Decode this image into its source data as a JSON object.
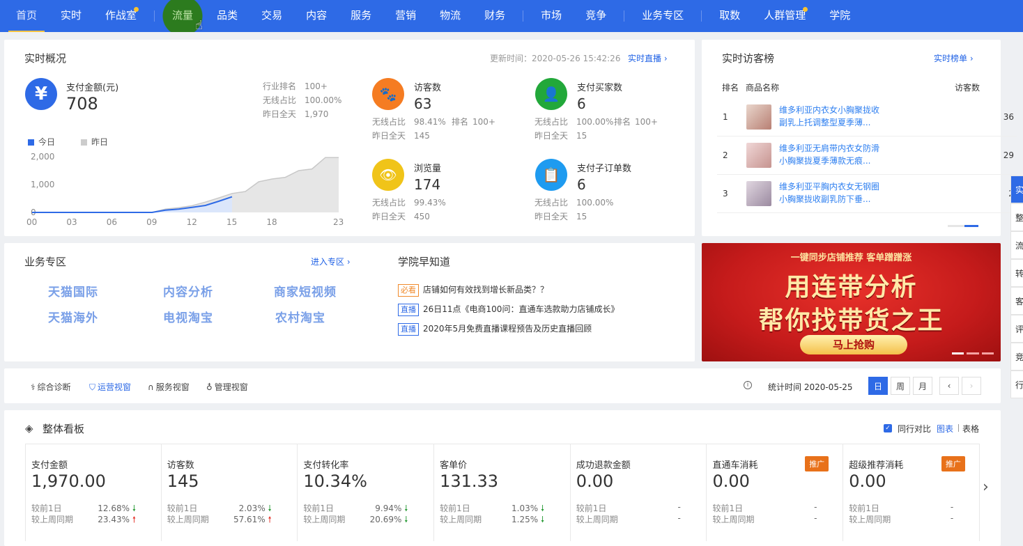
{
  "nav": {
    "items": [
      {
        "label": "首页",
        "active": true,
        "dot": false
      },
      {
        "label": "实时",
        "dot": false
      },
      {
        "label": "作战室",
        "dot": true
      },
      {
        "sep": true
      },
      {
        "label": "流量",
        "dot": false,
        "hover": true
      },
      {
        "label": "品类",
        "dot": false
      },
      {
        "label": "交易",
        "dot": false
      },
      {
        "label": "内容",
        "dot": false
      },
      {
        "label": "服务",
        "dot": false
      },
      {
        "label": "营销",
        "dot": false
      },
      {
        "label": "物流",
        "dot": false
      },
      {
        "label": "财务",
        "dot": false
      },
      {
        "sep": true
      },
      {
        "label": "市场",
        "dot": false
      },
      {
        "label": "竞争",
        "dot": false
      },
      {
        "sep": true
      },
      {
        "label": "业务专区",
        "dot": false
      },
      {
        "sep": true
      },
      {
        "label": "取数",
        "dot": false
      },
      {
        "label": "人群管理",
        "dot": true
      },
      {
        "label": "学院",
        "dot": false
      }
    ]
  },
  "realtime": {
    "title": "实时概况",
    "update_label": "更新时间：2020-05-26 15:42:26",
    "live_link": "实时直播",
    "pay": {
      "label": "支付金额(元)",
      "value": "708",
      "stats": [
        {
          "k": "行业排名",
          "v": "100+"
        },
        {
          "k": "无线占比",
          "v": "100.00%"
        },
        {
          "k": "昨日全天",
          "v": "1,970"
        }
      ]
    },
    "visitors": {
      "label": "访客数",
      "value": "63",
      "wireless_k": "无线占比",
      "wireless": "98.41%",
      "rank_k": "排名",
      "rank": "100+",
      "yday_k": "昨日全天",
      "yday": "145"
    },
    "buyers": {
      "label": "支付买家数",
      "value": "6",
      "wireless_k": "无线占比",
      "wireless": "100.00%",
      "rank_k": "排名",
      "rank": "100+",
      "yday_k": "昨日全天",
      "yday": "15"
    },
    "pv": {
      "label": "浏览量",
      "value": "174",
      "wireless_k": "无线占比",
      "wireless": "99.43%",
      "yday_k": "昨日全天",
      "yday": "450"
    },
    "suborders": {
      "label": "支付子订单数",
      "value": "6",
      "wireless_k": "无线占比",
      "wireless": "100.00%",
      "yday_k": "昨日全天",
      "yday": "15"
    },
    "legend_today": "今日",
    "legend_yesterday": "昨日"
  },
  "chart_data": {
    "type": "area",
    "x": [
      "00",
      "01",
      "02",
      "03",
      "04",
      "05",
      "06",
      "07",
      "08",
      "09",
      "10",
      "11",
      "12",
      "13",
      "14",
      "15",
      "16",
      "17",
      "18",
      "19",
      "20",
      "21",
      "22",
      "23"
    ],
    "xticks": [
      "00",
      "03",
      "06",
      "09",
      "12",
      "15",
      "18",
      "23"
    ],
    "yticks": [
      "2,000",
      "1,000",
      "0"
    ],
    "ylim": [
      0,
      2000
    ],
    "series": [
      {
        "name": "今日",
        "color": "#2e6ae6",
        "values": [
          0,
          0,
          0,
          0,
          0,
          0,
          0,
          0,
          0,
          0,
          80,
          120,
          180,
          250,
          400,
          560
        ]
      },
      {
        "name": "昨日",
        "color": "#c8c8c8",
        "values": [
          0,
          0,
          0,
          0,
          0,
          0,
          0,
          0,
          0,
          0,
          120,
          170,
          240,
          370,
          520,
          680,
          750,
          1100,
          1200,
          1260,
          1500,
          1560,
          1970,
          1970
        ]
      }
    ]
  },
  "visitor_rank": {
    "title": "实时访客榜",
    "link": "实时榜单",
    "col_rank": "排名",
    "col_name": "商品名称",
    "col_visitors": "访客数",
    "rows": [
      {
        "rank": "1",
        "name": "维多利亚内衣女小胸聚拢收副乳上托调整型夏季薄...",
        "visitors": "36"
      },
      {
        "rank": "2",
        "name": "维多利亚无肩带内衣女防滑小胸聚拢夏季薄款无痕...",
        "visitors": "29"
      },
      {
        "rank": "3",
        "name": "维多利亚平胸内衣女无钢圈小胸聚拢收副乳防下垂...",
        "visitors": "2"
      }
    ]
  },
  "biz_zone": {
    "title": "业务专区",
    "link": "进入专区",
    "items": [
      "天猫国际",
      "内容分析",
      "商家短视频",
      "天猫海外",
      "电视淘宝",
      "农村淘宝"
    ]
  },
  "academy": {
    "title": "学院早知道",
    "items": [
      {
        "tag": "必看",
        "must": true,
        "text": "店铺如何有效找到增长新品类？？"
      },
      {
        "tag": "直播",
        "must": false,
        "text": "26日11点《电商100问：直通车选款助力店铺成长》"
      },
      {
        "tag": "直播",
        "must": false,
        "text": "2020年5月免费直播课程预告及历史直播回顾"
      }
    ]
  },
  "banner": {
    "top": "一键同步店铺推荐 客单蹭蹭涨",
    "line1": "用连带分析",
    "line2": "帮你找带货之王",
    "cta": "马上抢购"
  },
  "view_tabs": {
    "items": [
      {
        "label": "综合诊断",
        "icon": "stethoscope-icon"
      },
      {
        "label": "运营视窗",
        "icon": "shield-icon",
        "active": true
      },
      {
        "label": "服务视窗",
        "icon": "headset-icon"
      },
      {
        "label": "管理视窗",
        "icon": "medal-icon"
      }
    ],
    "stat_time": "统计时间 2020-05-25",
    "periods": [
      "日",
      "周",
      "月"
    ]
  },
  "board": {
    "title": "整体看板",
    "compare_label": "同行对比",
    "view_chart": "图表",
    "view_table": "表格",
    "kpis": [
      {
        "label": "支付金额",
        "value": "1,970.00",
        "d1_k": "较前1日",
        "d1": "12.68%",
        "d1_dir": "down",
        "w_k": "较上周同期",
        "w": "23.43%",
        "w_dir": "up"
      },
      {
        "label": "访客数",
        "value": "145",
        "d1_k": "较前1日",
        "d1": "2.03%",
        "d1_dir": "down",
        "w_k": "较上周同期",
        "w": "57.61%",
        "w_dir": "up"
      },
      {
        "label": "支付转化率",
        "value": "10.34%",
        "d1_k": "较前1日",
        "d1": "9.94%",
        "d1_dir": "down",
        "w_k": "较上周同期",
        "w": "20.69%",
        "w_dir": "down"
      },
      {
        "label": "客单价",
        "value": "131.33",
        "d1_k": "较前1日",
        "d1": "1.03%",
        "d1_dir": "down",
        "w_k": "较上周同期",
        "w": "1.25%",
        "w_dir": "down"
      },
      {
        "label": "成功退款金额",
        "value": "0.00",
        "d1_k": "较前1日",
        "d1": "-",
        "w_k": "较上周同期",
        "w": "-"
      },
      {
        "label": "直通车消耗",
        "value": "0.00",
        "promo": "推广",
        "d1_k": "较前1日",
        "d1": "-",
        "w_k": "较上周同期",
        "w": "-"
      },
      {
        "label": "超级推荐消耗",
        "value": "0.00",
        "promo": "推广",
        "d1_k": "较前1日",
        "d1": "-",
        "w_k": "较上周同期",
        "w": "-"
      }
    ]
  },
  "side_tabs": [
    "实",
    "整",
    "流",
    "转",
    "客",
    "评",
    "竞",
    "行"
  ]
}
